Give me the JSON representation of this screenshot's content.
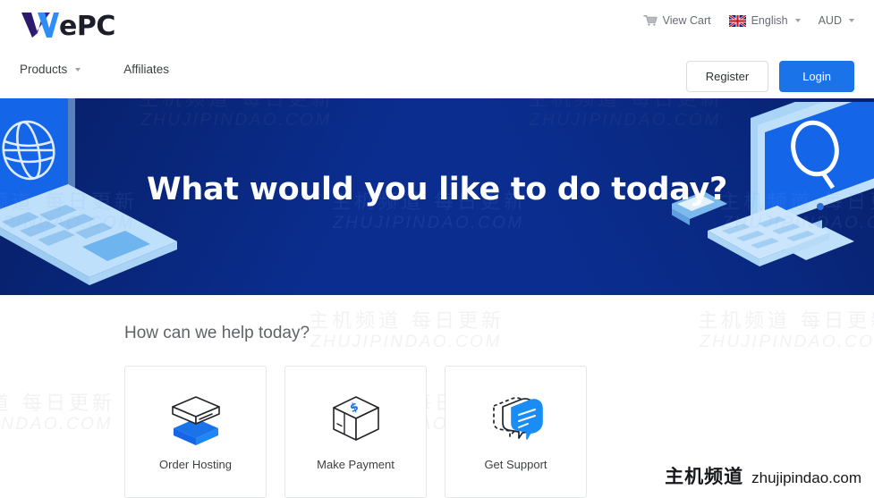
{
  "brand": {
    "name_w": "W",
    "name_rest": "ePC"
  },
  "utility": {
    "cart": {
      "label": "View Cart",
      "icon": "shopping-cart-icon"
    },
    "language": {
      "label": "English",
      "icon": "uk-flag-icon",
      "caret": "chevron-down-icon"
    },
    "currency": {
      "label": "AUD",
      "caret": "chevron-down-icon"
    }
  },
  "nav": {
    "items": [
      {
        "label": "Products",
        "has_caret": true
      },
      {
        "label": "Affiliates",
        "has_caret": false
      }
    ]
  },
  "auth": {
    "register_label": "Register",
    "login_label": "Login"
  },
  "hero": {
    "title": "What would you like to do today?",
    "background_color": "#0a2d8f",
    "left_art": "isometric-laptop-globe-illustration",
    "right_art": "isometric-desktop-search-illustration"
  },
  "help": {
    "title": "How can we help today?",
    "cards": [
      {
        "label": "Order Hosting",
        "icon": "open-box-icon"
      },
      {
        "label": "Make Payment",
        "icon": "package-dollar-icon"
      },
      {
        "label": "Get Support",
        "icon": "chat-bubbles-icon"
      }
    ]
  },
  "watermark": {
    "cn": "主机频道 每日更新",
    "en": "ZHUJIPINDAO.COM",
    "site_cn": "主机频道",
    "site_en": "zhujipindao.com"
  },
  "colors": {
    "accent_blue": "#1a73e8",
    "hero_navy": "#0a2d8f",
    "logo_purple": "#2b1a6e",
    "logo_blue": "#2e8ef7"
  }
}
